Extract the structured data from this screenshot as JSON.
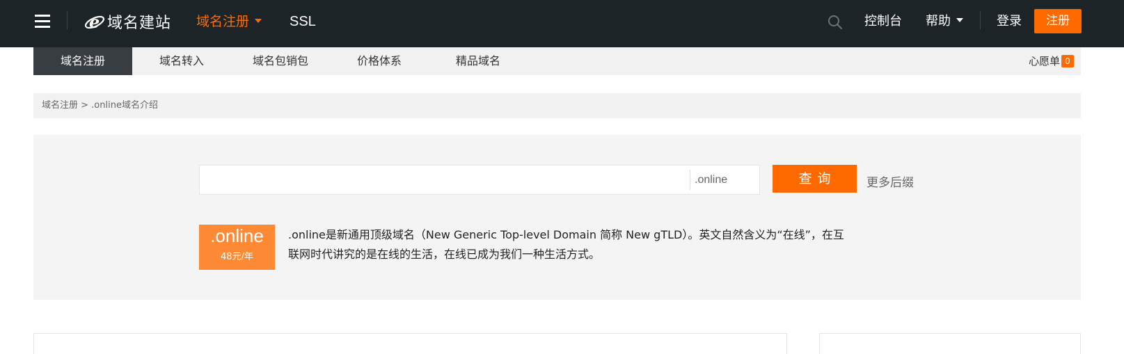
{
  "header": {
    "logo_text": "域名建站",
    "nav_active": "域名注册",
    "nav_ssl": "SSL",
    "console": "控制台",
    "help": "帮助",
    "login": "登录",
    "register": "注册",
    "accent_color": "#ff6a00",
    "icons": [
      "menu-icon",
      "ie-logo-icon",
      "search-icon",
      "chevron-down-icon"
    ]
  },
  "subnav": {
    "items": [
      {
        "label": "域名注册",
        "active": true
      },
      {
        "label": "域名转入",
        "active": false
      },
      {
        "label": "域名包销包",
        "active": false
      },
      {
        "label": "价格体系",
        "active": false
      },
      {
        "label": "精品域名",
        "active": false
      }
    ],
    "wishlist_label": "心愿单",
    "wishlist_count": "0"
  },
  "breadcrumb": {
    "text": "域名注册 > .online域名介绍"
  },
  "search": {
    "value": "",
    "placeholder": "",
    "suffix": ".online",
    "query_button": "查询",
    "more_suffix": "更多后缀"
  },
  "tld": {
    "name": ".online",
    "price": "48元/年",
    "description": ".online是新通用顶级域名（New Generic Top-level Domain 简称 New gTLD）。英文自然含义为“在线”，在互联网时代讲究的是在线的生活，在线已成为我们一种生活方式。"
  }
}
